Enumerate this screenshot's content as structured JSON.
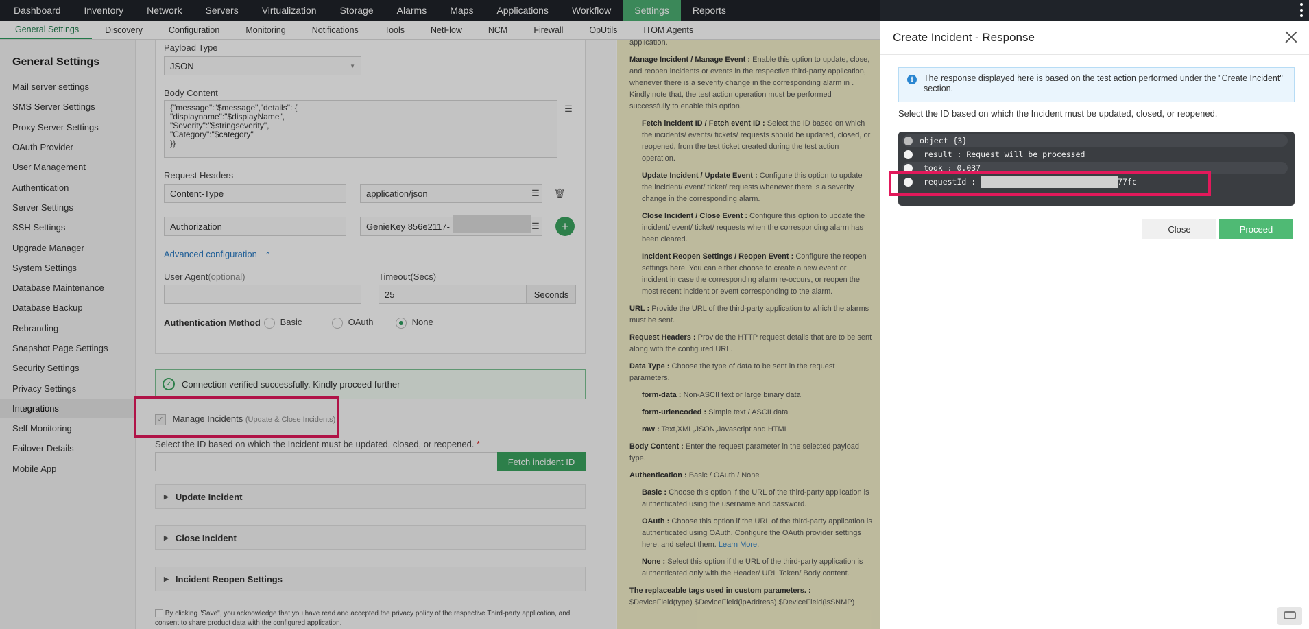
{
  "topnav": [
    "Dashboard",
    "Inventory",
    "Network",
    "Servers",
    "Virtualization",
    "Storage",
    "Alarms",
    "Maps",
    "Applications",
    "Workflow",
    "Settings",
    "Reports"
  ],
  "subnav": [
    "General Settings",
    "Discovery",
    "Configuration",
    "Monitoring",
    "Notifications",
    "Tools",
    "NetFlow",
    "NCM",
    "Firewall",
    "OpUtils",
    "ITOM Agents"
  ],
  "sidebar": {
    "title": "General Settings",
    "items": [
      "Mail server settings",
      "SMS Server Settings",
      "Proxy Server Settings",
      "OAuth Provider",
      "User Management",
      "Authentication",
      "Server Settings",
      "SSH Settings",
      "Upgrade Manager",
      "System Settings",
      "Database Maintenance",
      "Database Backup",
      "Rebranding",
      "Snapshot Page Settings",
      "Security Settings",
      "Privacy Settings",
      "Integrations",
      "Self Monitoring",
      "Failover Details",
      "Mobile App"
    ]
  },
  "form": {
    "payload_label": "Payload Type",
    "payload_value": "JSON",
    "body_label": "Body Content",
    "body_value": "{\"message\":\"$message\",\"details\": {\n\"displayname\":\"$displayName\",\n\"Severity\":\"$stringseverity\",\n\"Category\":\"$category\"\n}}",
    "headers_label": "Request Headers",
    "header1_key": "Content-Type",
    "header1_value": "application/json",
    "header2_key": "Authorization",
    "header2_value": "GenieKey 856e2117-",
    "advanced": "Advanced configuration",
    "user_agent_label": "User Agent",
    "user_agent_optional": "(optional)",
    "timeout_label": "Timeout(Secs)",
    "timeout_value": "25",
    "timeout_unit": "Seconds",
    "auth_label": "Authentication Method",
    "auth_options": [
      "Basic",
      "OAuth",
      "None"
    ],
    "success_msg": "Connection verified successfully. Kindly proceed further",
    "manage_label": "Manage Incidents",
    "manage_sub": "(Update & Close Incidents)",
    "select_id_label": "Select the ID based on which the Incident must be updated, closed, or reopened.",
    "required_mark": "*",
    "fetch_btn": "Fetch incident ID",
    "accordions": [
      "Update Incident",
      "Close Incident",
      "Incident Reopen Settings"
    ],
    "consent": "By clicking \"Save\", you acknowledge that you have read and accepted the privacy policy of the respective Third-party application, and consent to share product data with the configured application."
  },
  "help": {
    "top": "application.",
    "manage_title": "Manage Incident / Manage Event :",
    "manage_text": "Enable this option to update, close, and reopen incidents or events in the respective third-party application, whenever there is a severity change in the corresponding alarm in . Kindly note that, the test action operation must be performed successfully to enable this option.",
    "fetch_title": "Fetch incident ID / Fetch event ID :",
    "fetch_text": "Select the ID based on which the incidents/ events/ tickets/ requests should be updated, closed, or reopened, from the test ticket created during the test action operation.",
    "update_title": "Update Incident / Update Event :",
    "update_text": "Configure this option to update the incident/ event/ ticket/ requests whenever there is a severity change in the corresponding alarm.",
    "close_title": "Close Incident / Close Event :",
    "close_text": "Configure this option to update the incident/ event/ ticket/ requests when the corresponding alarm has been cleared.",
    "reopen_title": "Incident Reopen Settings / Reopen Event :",
    "reopen_text": "Configure the reopen settings here. You can either choose to create a new event or incident in case the corresponding alarm re-occurs, or reopen the most recent incident or event corresponding to the alarm.",
    "url_title": "URL :",
    "url_text": "Provide the URL of the third-party application to which the alarms must be sent.",
    "rh_title": "Request Headers :",
    "rh_text": "Provide the HTTP request details that are to be sent along with the configured URL.",
    "dt_title": "Data Type :",
    "dt_text": "Choose the type of data to be sent in the request parameters.",
    "fd_title": "form-data :",
    "fd_text": "Non-ASCII text or large binary data",
    "fu_title": "form-urlencoded :",
    "fu_text": "Simple text / ASCII data",
    "raw_title": "raw :",
    "raw_text": "Text,XML,JSON,Javascript and HTML",
    "bc_title": "Body Content :",
    "bc_text": "Enter the request parameter in the selected payload type.",
    "auth_title": "Authentication :",
    "auth_text": "Basic / OAuth / None",
    "basic_title": "Basic :",
    "basic_text": "Choose this option if the URL of the third-party application is authenticated using the username and password.",
    "oauth_title": "OAuth :",
    "oauth_text": "Choose this option if the URL of the third-party application is authenticated using OAuth. Configure the OAuth provider settings here, and select them.",
    "learn_more": "Learn More",
    "none_title": "None :",
    "none_text": "Select this option if the URL of the third-party application is authenticated only with the Header/ URL Token/ Body content.",
    "tags_title": "The replaceable tags used in custom parameters. :",
    "tags_text": "$DeviceField(type) $DeviceField(ipAddress) $DeviceField(isSNMP)"
  },
  "modal": {
    "title": "Create Incident - Response",
    "info": "The response displayed here is based on the test action performed under the \"Create Incident\" section.",
    "select_msg": "Select the ID based on which the Incident must be updated, closed, or reopened.",
    "json_rows": [
      {
        "key": "object",
        "value": "{3}"
      },
      {
        "key": "result",
        "value": "Request will be processed"
      },
      {
        "key": "took",
        "value": "0.037"
      },
      {
        "key": "requestId",
        "value": "77fc"
      }
    ],
    "close_btn": "Close",
    "proceed_btn": "Proceed"
  },
  "colors": {
    "accent": "#4caf72",
    "highlight": "#e2195b",
    "help_bg": "#f3efc9"
  }
}
